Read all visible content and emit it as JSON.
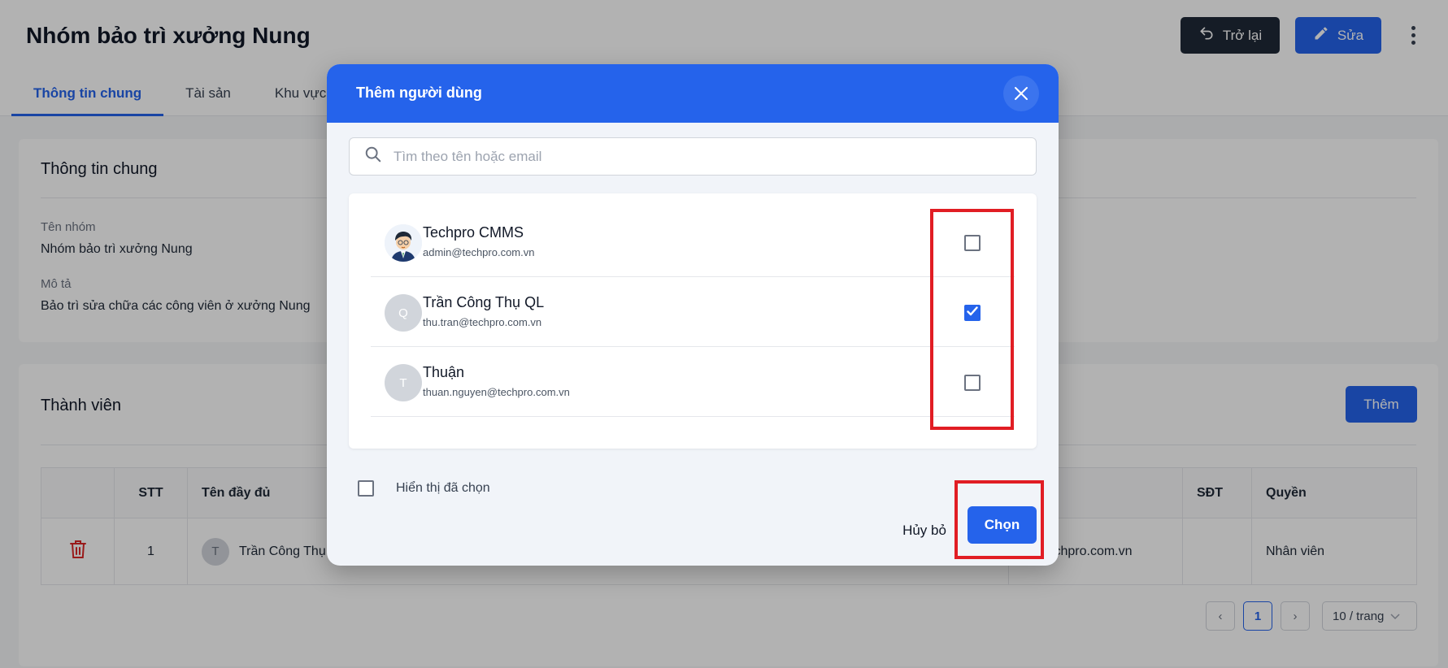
{
  "page": {
    "title": "Nhóm bảo trì xưởng Nung",
    "back_label": "Trở lại",
    "edit_label": "Sửa",
    "tabs": [
      {
        "label": "Thông tin chung",
        "active": true
      },
      {
        "label": "Tài sản",
        "active": false
      },
      {
        "label": "Khu vực",
        "active": false
      }
    ]
  },
  "info": {
    "title": "Thông tin chung",
    "group_name_label": "Tên nhóm",
    "group_name_value": "Nhóm bảo trì xưởng Nung",
    "description_label": "Mô tả",
    "description_value": "Bảo trì sửa chữa các công viên ở xưởng Nung"
  },
  "members": {
    "title": "Thành viên",
    "add_label": "Thêm",
    "columns": [
      "STT",
      "Tên đầy đủ",
      "SĐT",
      "Quyền"
    ],
    "rows": [
      {
        "stt": "1",
        "avatar": "T",
        "name": "Trần Công Thụ QL",
        "email": "n@techpro.com.vn",
        "phone": "",
        "role": "Nhân viên"
      }
    ],
    "pagination": {
      "current_page": "1",
      "page_size": "10 / trang"
    }
  },
  "modal": {
    "title": "Thêm người dùng",
    "search_placeholder": "Tìm theo tên hoặc email",
    "users": [
      {
        "name": "Techpro CMMS",
        "email": "admin@techpro.com.vn",
        "avatar": "",
        "checked": false
      },
      {
        "name": "Trần Công Thụ QL",
        "email": "thu.tran@techpro.com.vn",
        "avatar": "Q",
        "checked": true
      },
      {
        "name": "Thuận",
        "email": "thuan.nguyen@techpro.com.vn",
        "avatar": "T",
        "checked": false
      }
    ],
    "show_selected_label": "Hiển thị đã chọn",
    "cancel_label": "Hủy bỏ",
    "choose_label": "Chọn"
  },
  "colors": {
    "primary": "#2563eb",
    "dark_button": "#1f2937",
    "highlight": "#e11d24",
    "delete_icon": "#dc2626"
  },
  "icons": [
    "undo-icon",
    "pencil-icon",
    "more-vertical-icon",
    "trash-icon",
    "close-icon",
    "search-icon",
    "check-icon",
    "chevron-left-icon",
    "chevron-right-icon",
    "chevron-down-icon"
  ]
}
